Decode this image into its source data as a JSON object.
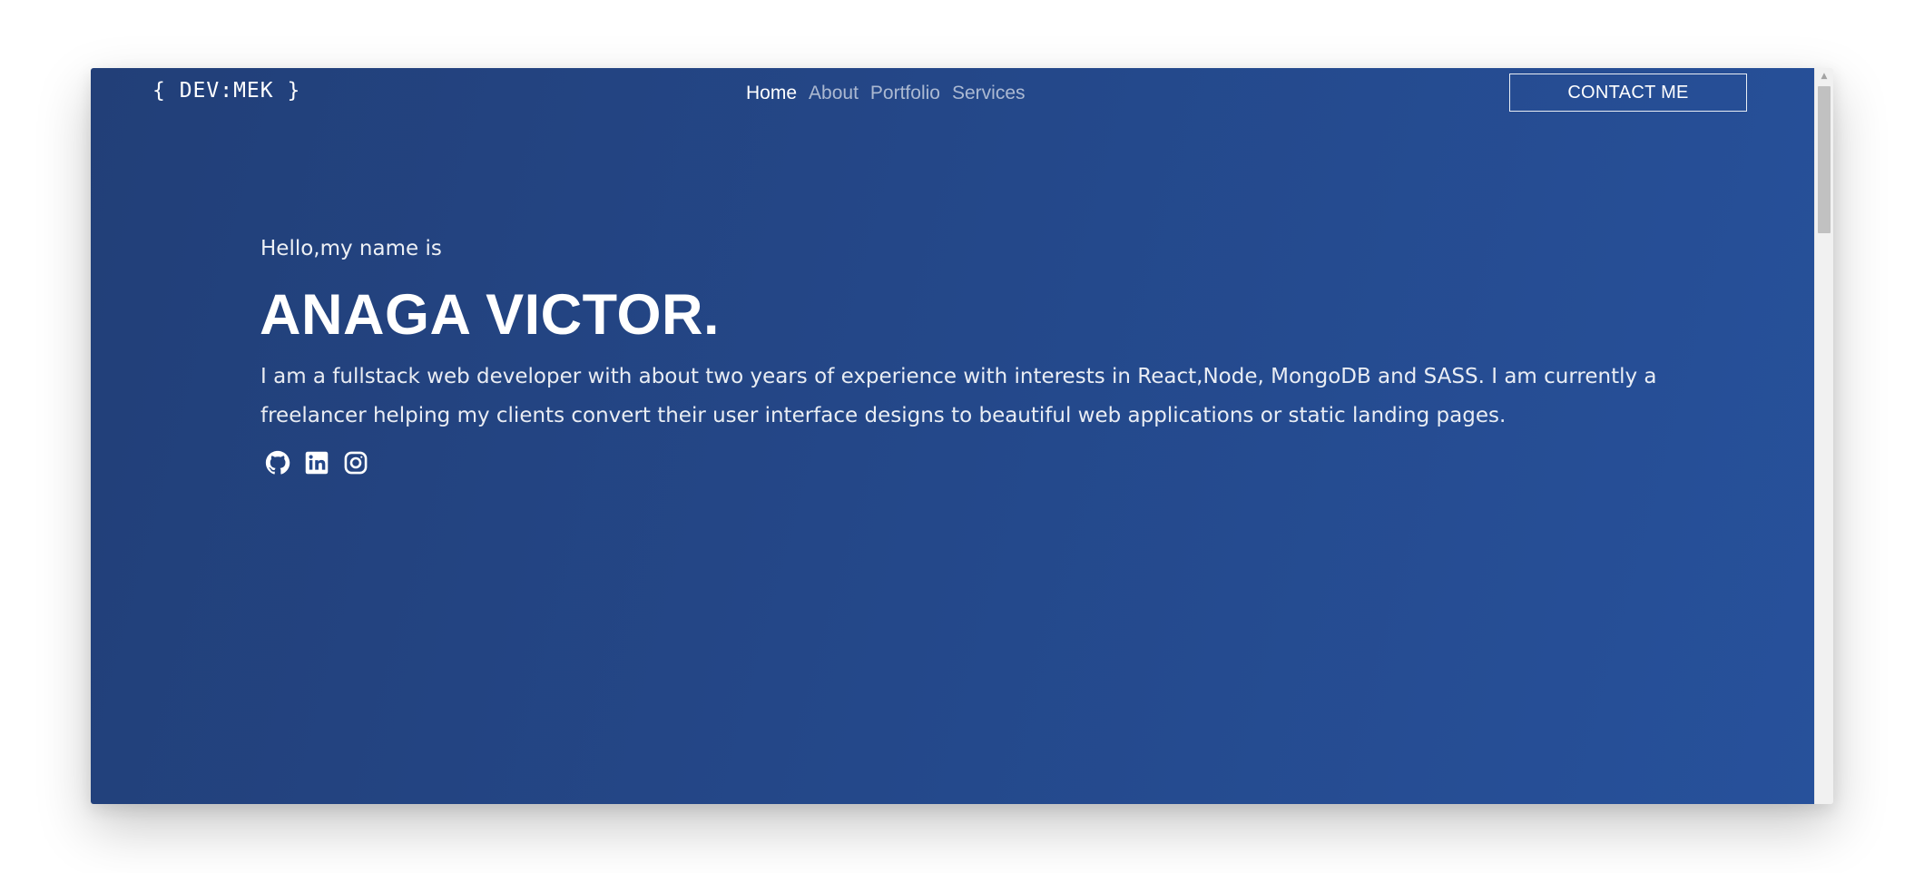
{
  "header": {
    "logo": "{ DEV:MEK }",
    "nav": [
      {
        "label": "Home",
        "active": true
      },
      {
        "label": "About",
        "active": false
      },
      {
        "label": "Portfolio",
        "active": false
      },
      {
        "label": "Services",
        "active": false
      }
    ],
    "contact_label": "CONTACT ME"
  },
  "hero": {
    "greeting": "Hello,my name is",
    "name": "ANAGA VICTOR.",
    "bio": "I am a fullstack web developer with about two years of experience with interests in React,Node, MongoDB and SASS. I am currently a freelancer helping my clients convert their user interface designs to beautiful web applications or static landing pages.",
    "socials": [
      {
        "icon": "github-icon"
      },
      {
        "icon": "linkedin-icon"
      },
      {
        "icon": "instagram-icon"
      }
    ]
  },
  "colors": {
    "background_start": "#223f78",
    "background_end": "#27519b",
    "text": "#ffffff",
    "nav_inactive": "rgba(255,255,255,0.62)"
  }
}
